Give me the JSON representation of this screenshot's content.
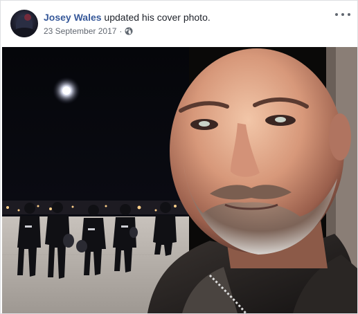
{
  "post": {
    "author_name": "Josey Wales",
    "action_text": "updated his cover photo.",
    "date": "23 September 2017",
    "separator": "·",
    "privacy_icon": "globe-icon",
    "more_icon": "more-options-icon",
    "photo_description_icon": "cover-photo"
  },
  "colors": {
    "name_link": "#365899",
    "meta_text": "#616770",
    "body_text": "#1d2129",
    "border": "#dddfe2"
  }
}
